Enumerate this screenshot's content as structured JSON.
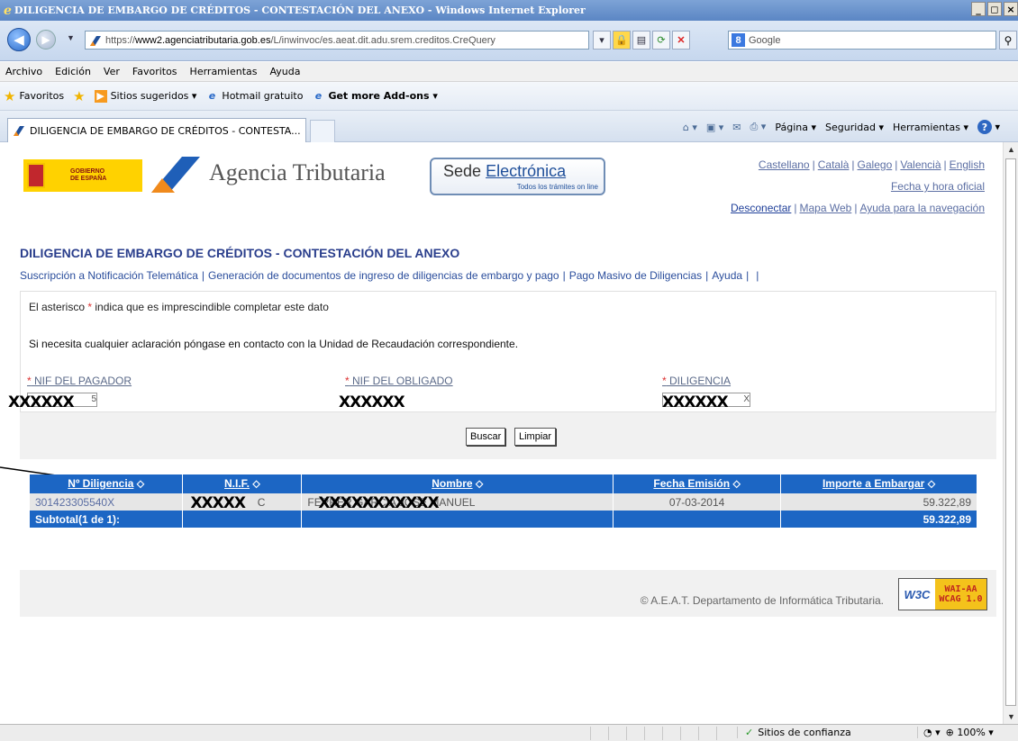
{
  "window": {
    "title": "DILIGENCIA DE EMBARGO DE CRÉDITOS - CONTESTACIÓN DEL ANEXO - Windows Internet Explorer",
    "min": "_",
    "max": "◻",
    "close": "×"
  },
  "address": {
    "scheme": "https://",
    "host": "www2.agenciatributaria.gob.es",
    "path": "/L/inwinvoc/es.aeat.dit.adu.srem.creditos.CreQuery",
    "search_placeholder": "Google"
  },
  "menu": [
    "Archivo",
    "Edición",
    "Ver",
    "Favoritos",
    "Herramientas",
    "Ayuda"
  ],
  "favorites": {
    "label": "Favoritos",
    "items": [
      "Sitios sugeridos ▾",
      "Hotmail gratuito",
      "Get more Add-ons ▾"
    ]
  },
  "tab": {
    "label": "DILIGENCIA DE EMBARGO DE CRÉDITOS - CONTESTA..."
  },
  "commandbar": {
    "page": "Página ▾",
    "security": "Seguridad ▾",
    "tools": "Herramientas ▾"
  },
  "header": {
    "gob_text_1": "GOBIERNO",
    "gob_text_2": "DE ESPAÑA",
    "agency_name": "Agencia Tributaria",
    "sede_1": "Sede",
    "sede_2": "Electrónica",
    "sede_tagline": "Todos los trámites on line",
    "languages": [
      "Castellano",
      "Català",
      "Galego",
      "Valencià",
      "English"
    ],
    "datetime_link": "Fecha y hora oficial",
    "nav_links": [
      "Desconectar",
      "Mapa Web",
      "Ayuda para la navegación"
    ]
  },
  "page": {
    "title": "DILIGENCIA DE EMBARGO DE CRÉDITOS - CONTESTACIÓN DEL ANEXO",
    "subnav": [
      "Suscripción a Notificación Telemática",
      "Generación de documentos de ingreso de diligencias de embargo y pago",
      "Pago Masivo de Diligencias",
      "Ayuda"
    ],
    "asterisk_note_pre": "El asterisco",
    "asterisk_note_post": "indica que es imprescindible completar este dato",
    "contact_note": "Si necesita cualquier aclaración póngase en contacto con la Unidad de Recaudación correspondiente.",
    "fields": {
      "pagador": {
        "label": "NIF DEL PAGADOR",
        "value": "5",
        "redaction": "XXXXXX"
      },
      "obligado": {
        "label": "NIF DEL OBLIGADO",
        "value": "",
        "redaction": "XXXXXX"
      },
      "diligencia": {
        "label": "DILIGENCIA",
        "value": "X",
        "redaction": "XXXXXX"
      }
    },
    "buttons": {
      "search": "Buscar",
      "clear": "Limpiar"
    }
  },
  "results": {
    "headers": [
      "Nº Diligencia",
      "N.I.F.",
      "Nombre",
      "Fecha Emisión",
      "Importe a Embargar"
    ],
    "sort_glyph": "⬦",
    "rows": [
      {
        "diligencia": "301423305540X",
        "nif": "C",
        "nif_redaction": "XXXXX",
        "nombre": "FERRER GARCIA JOSE MANUEL",
        "nombre_redaction": "XXXXXXXXXXX",
        "fecha": "07-03-2014",
        "importe": "59.322,89"
      }
    ],
    "subtotal_label": "Subtotal(1 de 1):",
    "subtotal_value": "59.322,89"
  },
  "footer": {
    "copyright": "© A.E.A.T. Departamento de Informática Tributaria.",
    "badge_w3c": "W3C",
    "badge_wai": "WAI-AA",
    "badge_wcag": "WCAG 1.0"
  },
  "statusbar": {
    "zone": "Sitios de confianza",
    "zoom": "100%"
  },
  "colors": {
    "header_blue": "#1c66c4",
    "title_blue": "#2a3e8c",
    "asterisk_red": "#dd3333"
  }
}
